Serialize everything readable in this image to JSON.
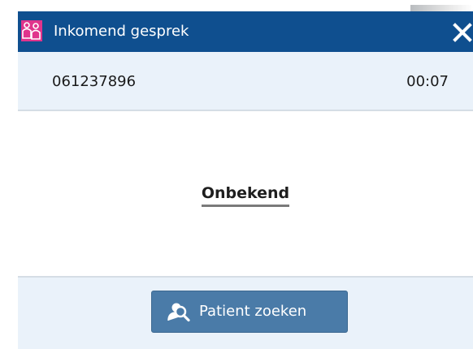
{
  "dialog": {
    "title": "Inkomend gesprek",
    "app_icon": "app-people-icon",
    "close_icon": "close-icon"
  },
  "call": {
    "phone_number": "061237896",
    "duration": "00:07",
    "caller_name": "Onbekend"
  },
  "actions": {
    "search_patient_label": "Patient zoeken",
    "search_patient_icon": "patient-search-icon"
  },
  "colors": {
    "titlebar": "#0f4f8f",
    "app_icon": "#e0348c",
    "panel_bg": "#eaf2fa",
    "button_bg": "#4a7ba8"
  }
}
